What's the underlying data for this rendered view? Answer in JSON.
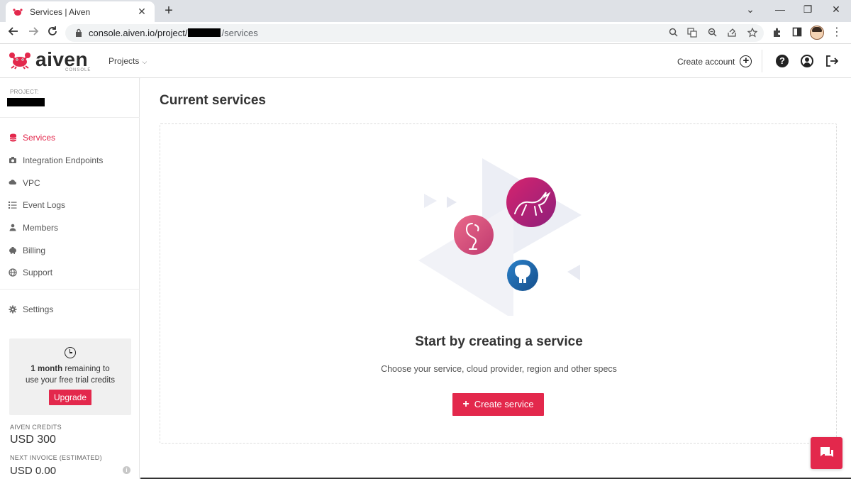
{
  "browser": {
    "tab_title": "Services | Aiven",
    "url_prefix": "console.aiven.io/project/",
    "url_suffix": "/services",
    "new_tab_glyph": "+",
    "close_tab_glyph": "✕",
    "window_controls": [
      "⌄",
      "—",
      "❐",
      "✕"
    ]
  },
  "header": {
    "brand": "aiven",
    "brand_sub": "CONSOLE",
    "projects_label": "Projects",
    "create_account_label": "Create account",
    "help_glyph": "?"
  },
  "sidebar": {
    "project_label": "PROJECT:",
    "items": [
      {
        "label": "Services",
        "icon": "database-icon",
        "active": true
      },
      {
        "label": "Integration Endpoints",
        "icon": "plug-icon",
        "active": false
      },
      {
        "label": "VPC",
        "icon": "cloud-icon",
        "active": false
      },
      {
        "label": "Event Logs",
        "icon": "list-icon",
        "active": false
      },
      {
        "label": "Members",
        "icon": "users-icon",
        "active": false
      },
      {
        "label": "Billing",
        "icon": "piggy-bank-icon",
        "active": false
      },
      {
        "label": "Support",
        "icon": "globe-icon",
        "active": false
      }
    ],
    "settings_label": "Settings",
    "trial": {
      "bold": "1 month",
      "text_line1": " remaining to",
      "text_line2": "use your free trial credits",
      "upgrade_label": "Upgrade"
    },
    "credits_label": "AIVEN CREDITS",
    "credits_value": "USD 300",
    "invoice_label": "NEXT INVOICE (ESTIMATED)",
    "invoice_value": "USD 0.00"
  },
  "main": {
    "title": "Current services",
    "empty_title": "Start by creating a service",
    "empty_subtitle": "Choose your service, cloud provider, region and other specs",
    "create_button_label": "Create service"
  },
  "colors": {
    "accent": "#e3284c",
    "kafka_gradient": [
      "#d6246e",
      "#8e1f7b"
    ],
    "flink_gradient": [
      "#e7547a",
      "#c03a70"
    ],
    "postgres_gradient": [
      "#1f6db8",
      "#164f8c"
    ]
  }
}
